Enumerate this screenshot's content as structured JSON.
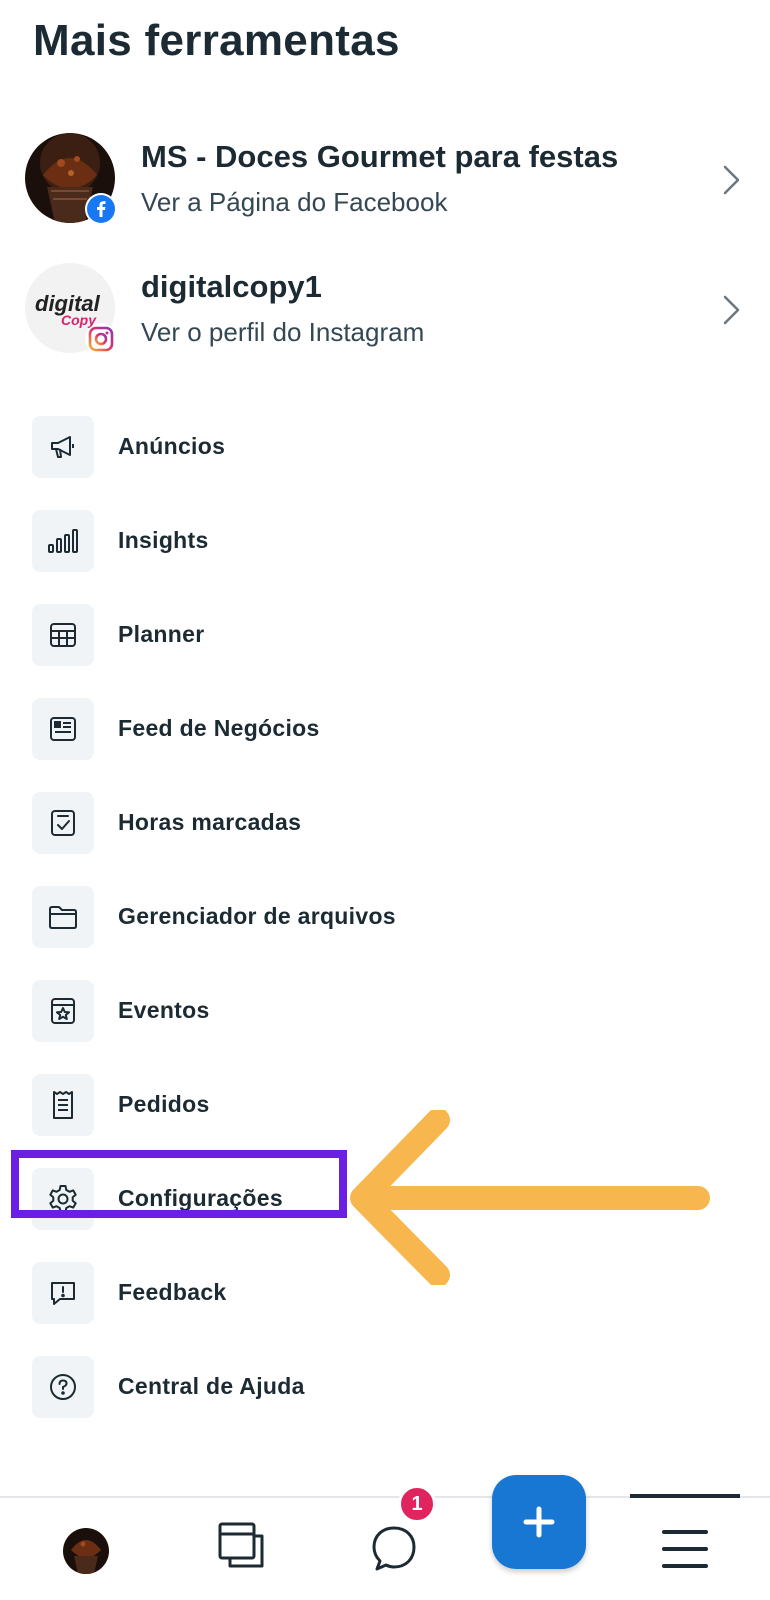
{
  "header": {
    "title": "Mais ferramentas"
  },
  "accounts": [
    {
      "name": "MS - Doces Gourmet para festas",
      "subtitle": "Ver a Página do Facebook",
      "platform_icon": "facebook-icon"
    },
    {
      "name": "digitalcopy1",
      "subtitle": "Ver o perfil do Instagram",
      "platform_icon": "instagram-icon",
      "avatar_text": "digital",
      "avatar_text2": "Copy"
    }
  ],
  "menu": {
    "items": [
      {
        "label": "Anúncios",
        "icon": "megaphone-icon"
      },
      {
        "label": "Insights",
        "icon": "bar-chart-icon"
      },
      {
        "label": "Planner",
        "icon": "calendar-grid-icon"
      },
      {
        "label": "Feed de Negócios",
        "icon": "feed-icon"
      },
      {
        "label": "Horas marcadas",
        "icon": "appointment-check-icon"
      },
      {
        "label": "Gerenciador de arquivos",
        "icon": "folder-icon"
      },
      {
        "label": "Eventos",
        "icon": "event-star-icon"
      },
      {
        "label": "Pedidos",
        "icon": "receipt-icon"
      },
      {
        "label": "Configurações",
        "icon": "gear-icon",
        "highlighted": true
      },
      {
        "label": "Feedback",
        "icon": "feedback-icon"
      },
      {
        "label": "Central de Ajuda",
        "icon": "help-icon"
      }
    ]
  },
  "bottom_nav": {
    "inbox_badge": "1",
    "create_label": "+"
  },
  "colors": {
    "highlight": "#6a1fe3",
    "arrow": "#f8b74e",
    "fab": "#1877d2",
    "badge": "#e0245e",
    "text": "#1c2b33"
  }
}
